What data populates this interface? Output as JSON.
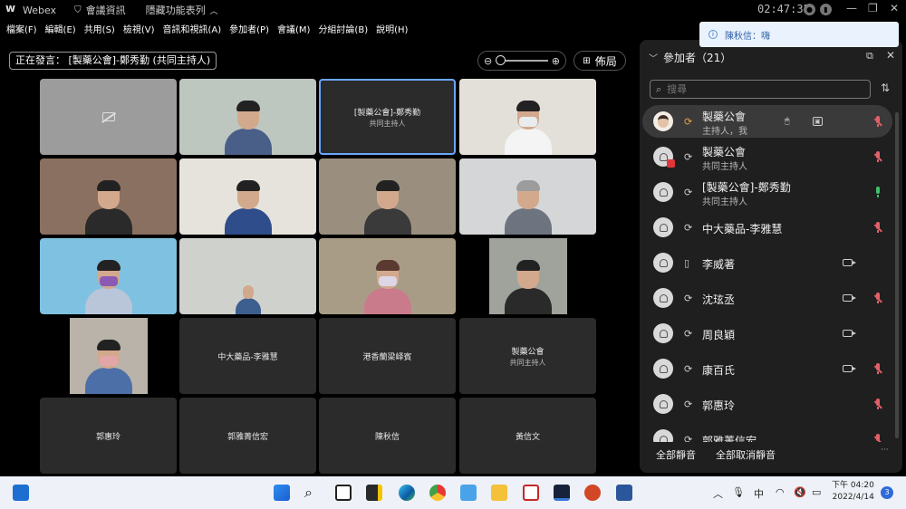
{
  "titlebar": {
    "app_name": "Webex",
    "meeting_info": "會議資訊",
    "hidden_menu": "隱藏功能表列",
    "clock": "02:47:35"
  },
  "menu": [
    "檔案(F)",
    "編輯(E)",
    "共用(S)",
    "檢視(V)",
    "音訊和視訊(A)",
    "參加者(P)",
    "會議(M)",
    "分組討論(B)",
    "說明(H)"
  ],
  "speaking": "正在發言： [製藥公會]-鄭秀勤 (共同主持人)",
  "layout_label": "佈局",
  "toast": "陳秋信：嗨",
  "grid": [
    {
      "label": "",
      "sub": "",
      "kind": "camoff"
    },
    {
      "label": "",
      "sub": "",
      "kind": "video"
    },
    {
      "label": "[製藥公會]-鄭秀勤",
      "sub": "共同主持人",
      "kind": "name",
      "active": true
    },
    {
      "label": "",
      "sub": "",
      "kind": "video"
    },
    {
      "label": "",
      "sub": "",
      "kind": "video"
    },
    {
      "label": "",
      "sub": "",
      "kind": "video"
    },
    {
      "label": "",
      "sub": "",
      "kind": "video"
    },
    {
      "label": "",
      "sub": "",
      "kind": "video"
    },
    {
      "label": "",
      "sub": "",
      "kind": "video"
    },
    {
      "label": "",
      "sub": "",
      "kind": "video"
    },
    {
      "label": "",
      "sub": "",
      "kind": "video"
    },
    {
      "label": "",
      "sub": "",
      "kind": "video"
    },
    {
      "label": "",
      "sub": "",
      "kind": "video"
    },
    {
      "label": "中大藥品-李雅慧",
      "sub": "",
      "kind": "name"
    },
    {
      "label": "港香蘭梁峄賓",
      "sub": "",
      "kind": "name"
    },
    {
      "label": "製藥公會",
      "sub": "共同主持人",
      "kind": "name"
    },
    {
      "label": "郭惠玲",
      "sub": "",
      "kind": "name"
    },
    {
      "label": "郭雅菁信宏",
      "sub": "",
      "kind": "name"
    },
    {
      "label": "陳秋信",
      "sub": "",
      "kind": "name"
    },
    {
      "label": "黃信文",
      "sub": "",
      "kind": "name"
    }
  ],
  "panel": {
    "title": "參加者（21）",
    "search_placeholder": "搜尋",
    "mute_all": "全部靜音",
    "unmute_all": "全部取消靜音",
    "participants": [
      {
        "name": "製藥公會",
        "role": "主持人，我",
        "device": "orange",
        "avatar": "photo",
        "pointer": true,
        "cc": true,
        "video": false,
        "mic": "muted",
        "highlight": true
      },
      {
        "name": "製藥公會",
        "role": "共同主持人",
        "device": "sync",
        "avatar": "badge",
        "video": false,
        "mic": "muted"
      },
      {
        "name": "[製藥公會]-鄭秀勤",
        "role": "共同主持人",
        "device": "sync",
        "avatar": "ghost",
        "video": false,
        "mic": "live"
      },
      {
        "name": "中大藥品-李雅慧",
        "role": "",
        "device": "sync",
        "avatar": "ghost",
        "video": false,
        "mic": "muted"
      },
      {
        "name": "李威著",
        "role": "",
        "device": "phone",
        "avatar": "ghost",
        "video": true,
        "mic": "none"
      },
      {
        "name": "沈玹丞",
        "role": "",
        "device": "sync",
        "avatar": "ghost",
        "video": true,
        "mic": "muted"
      },
      {
        "name": "周良穎",
        "role": "",
        "device": "sync",
        "avatar": "ghost",
        "video": true,
        "mic": "none"
      },
      {
        "name": "康百氏",
        "role": "",
        "device": "sync",
        "avatar": "ghost",
        "video": true,
        "mic": "muted"
      },
      {
        "name": "郭惠玲",
        "role": "",
        "device": "sync",
        "avatar": "ghost",
        "video": false,
        "mic": "muted"
      },
      {
        "name": "郭雅菁信宏",
        "role": "",
        "device": "sync",
        "avatar": "ghost",
        "video": false,
        "mic": "muted"
      }
    ]
  },
  "taskbar": {
    "ime": "中",
    "time": "下午 04:20",
    "date": "2022/4/14",
    "notifications": "3"
  },
  "colors": {
    "accent_blue": "#6aa6ff",
    "muted_red": "#e0606a",
    "live_green": "#3fbf6a",
    "host_orange": "#e8a23b"
  }
}
